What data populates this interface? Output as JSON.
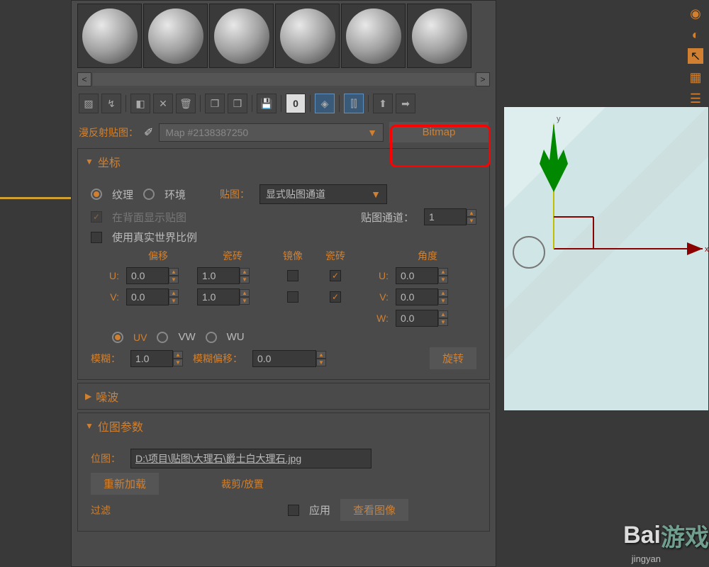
{
  "top": {
    "map_label": "漫反射贴图：",
    "map_name": "Map #2138387250",
    "bitmap_btn": "Bitmap"
  },
  "coord": {
    "header": "坐标",
    "radio_texture": "纹理",
    "radio_env": "环境",
    "map_label": "贴图：",
    "map_mode": "显式贴图通道",
    "back_show": "在背面显示贴图",
    "real_world": "使用真实世界比例",
    "channel_label": "贴图通道：",
    "channel_val": "1",
    "col_offset": "偏移",
    "col_tile": "瓷砖",
    "col_mirror": "镜像",
    "col_tile2": "瓷砖",
    "col_angle": "角度",
    "u_label": "U:",
    "v_label": "V:",
    "w_label": "W:",
    "u_offset": "0.0",
    "u_tile": "1.0",
    "u_angle": "0.0",
    "v_offset": "0.0",
    "v_tile": "1.0",
    "v_angle": "0.0",
    "w_angle": "0.0",
    "uv": "UV",
    "vw": "VW",
    "wu": "WU",
    "blur_label": "模糊：",
    "blur_val": "1.0",
    "blur_off_label": "模糊偏移：",
    "blur_off_val": "0.0",
    "rotate_btn": "旋转"
  },
  "noise": {
    "header": "噪波"
  },
  "bitmap": {
    "header": "位图参数",
    "path_label": "位图：",
    "path_val": "D:\\项目\\贴图\\大理石\\爵士白大理石.jpg",
    "reload_btn": "重新加载",
    "crop_label": "裁剪/放置",
    "apply_label": "应用",
    "view_btn": "查看图像",
    "filter_label": "过滤"
  },
  "watermark": {
    "main": "Bai",
    "sub": "jingyan",
    "game": "游戏"
  }
}
